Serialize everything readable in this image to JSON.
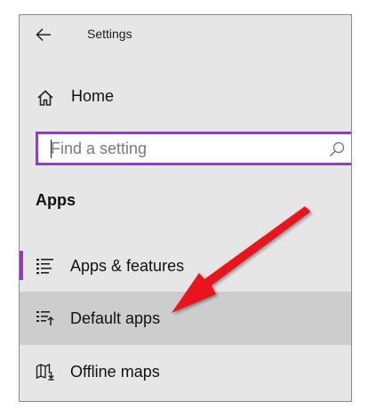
{
  "window": {
    "title": "Settings"
  },
  "home": {
    "label": "Home"
  },
  "search": {
    "placeholder": "Find a setting"
  },
  "section": {
    "heading": "Apps"
  },
  "nav_items": [
    {
      "label": "Apps & features",
      "icon": "apps-features-icon",
      "selected": true
    },
    {
      "label": "Default apps",
      "icon": "default-apps-icon",
      "hovered": true
    },
    {
      "label": "Offline maps",
      "icon": "offline-maps-icon"
    }
  ],
  "colors": {
    "accent": "#8f3fb8",
    "pane_background": "#e6e6e6",
    "hover_background": "#cdcdcd",
    "annotation_arrow": "#e8121b"
  }
}
